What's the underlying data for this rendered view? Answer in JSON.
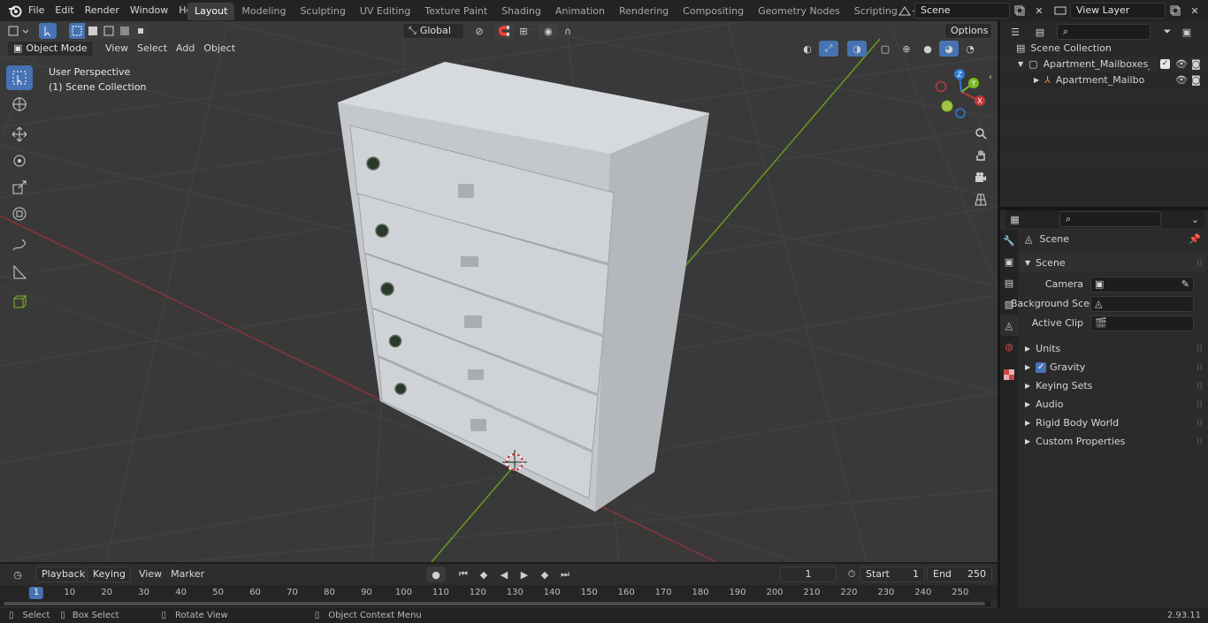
{
  "topbar": {
    "menus": [
      "File",
      "Edit",
      "Render",
      "Window",
      "Help"
    ],
    "workspaces": [
      "Layout",
      "Modeling",
      "Sculpting",
      "UV Editing",
      "Texture Paint",
      "Shading",
      "Animation",
      "Rendering",
      "Compositing",
      "Geometry Nodes",
      "Scripting"
    ],
    "active_workspace": "Layout",
    "scene_name": "Scene",
    "view_layer": "View Layer"
  },
  "viewport": {
    "mode": "Object Mode",
    "menus": [
      "View",
      "Select",
      "Add",
      "Object"
    ],
    "transform_orientation": "Global",
    "options_label": "Options",
    "overlay_line1": "User Perspective",
    "overlay_line2": "(1) Scene Collection",
    "gizmo_axes": [
      "X",
      "Y",
      "Z"
    ]
  },
  "outliner": {
    "root": "Scene Collection",
    "items": [
      {
        "label": "Apartment_Mailboxes_Grey_C"
      },
      {
        "label": "Apartment_Mailboxes_Gr"
      }
    ]
  },
  "properties": {
    "context_title": "Scene",
    "panel_title": "Scene",
    "fields": [
      {
        "label": "Camera"
      },
      {
        "label": "Background Scene"
      },
      {
        "label": "Active Clip"
      }
    ],
    "sections": [
      "Units",
      "Gravity",
      "Keying Sets",
      "Audio",
      "Rigid Body World",
      "Custom Properties"
    ],
    "gravity_checked": true
  },
  "timeline": {
    "menus": [
      "Playback",
      "Keying",
      "View",
      "Marker"
    ],
    "current_frame": "1",
    "start_label": "Start",
    "start": "1",
    "end_label": "End",
    "end": "250",
    "ruler": [
      "1",
      "10",
      "20",
      "30",
      "40",
      "50",
      "60",
      "70",
      "80",
      "90",
      "100",
      "110",
      "120",
      "130",
      "140",
      "150",
      "160",
      "170",
      "180",
      "190",
      "200",
      "210",
      "220",
      "230",
      "240",
      "250"
    ]
  },
  "statusbar": {
    "select": "Select",
    "box_select": "Box Select",
    "rotate_view": "Rotate View",
    "context_menu": "Object Context Menu",
    "version": "2.93.11"
  },
  "colors": {
    "accent": "#4772b3",
    "x_axis": "#c0393f",
    "y_axis": "#7cb820",
    "z_axis": "#2f7ad6"
  }
}
